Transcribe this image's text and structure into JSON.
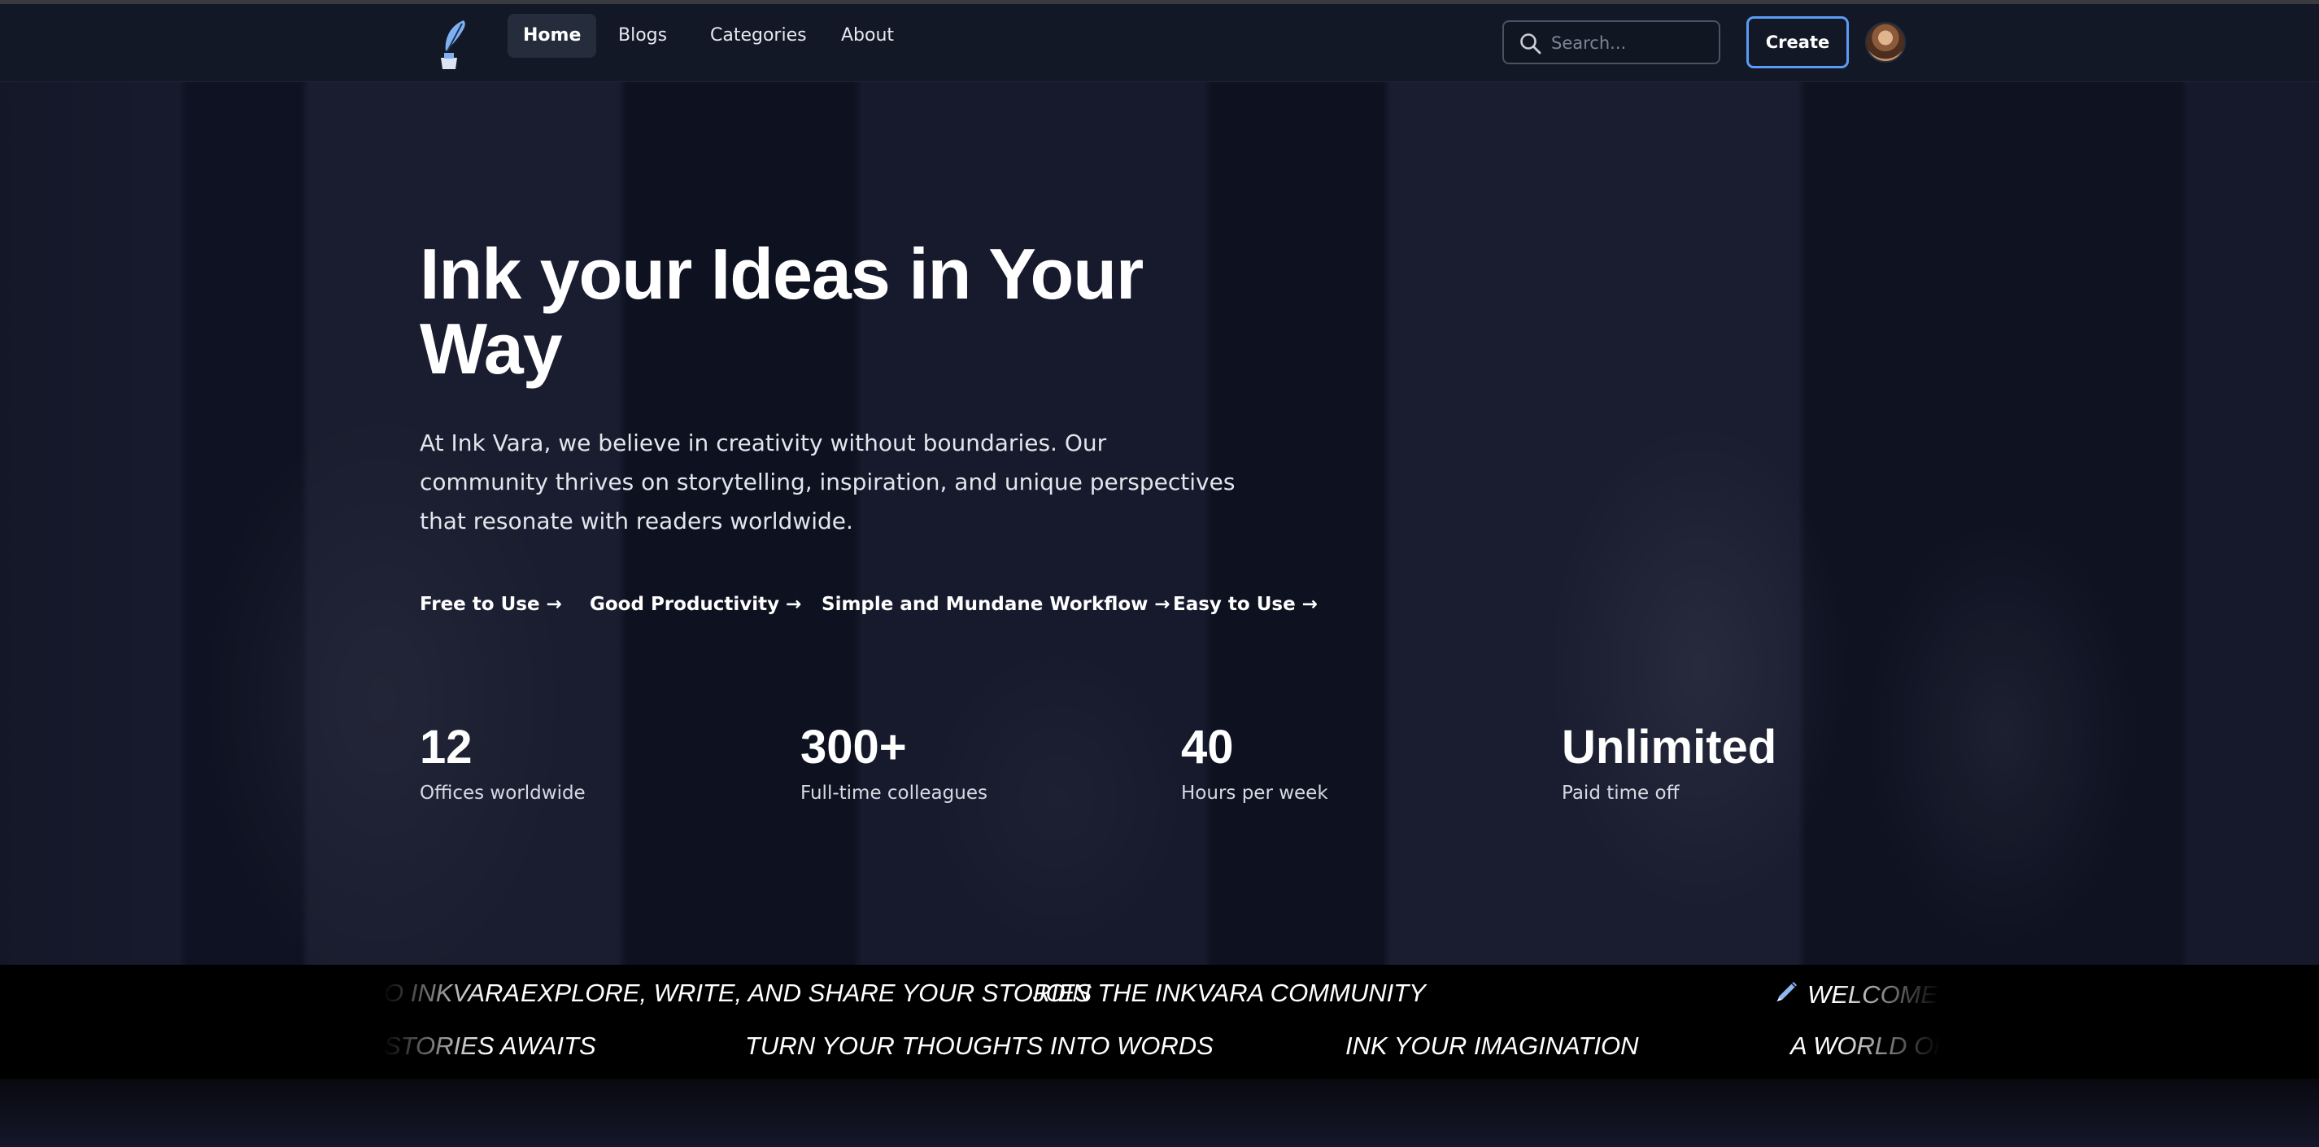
{
  "nav": {
    "items": [
      {
        "label": "Home",
        "active": true
      },
      {
        "label": "Blogs",
        "active": false
      },
      {
        "label": "Categories",
        "active": false
      },
      {
        "label": "About",
        "active": false
      }
    ],
    "search_placeholder": "Search...",
    "create_label": "Create",
    "logo_icon": "feather-ink-icon",
    "avatar_icon": "user-avatar"
  },
  "hero": {
    "title": "Ink your Ideas in Your Way",
    "description": "At Ink Vara, we believe in creativity without boundaries. Our community thrives on storytelling, inspiration, and unique perspectives that resonate with readers worldwide.",
    "features": [
      "Free to Use →",
      "Good Productivity →",
      "Simple and Mundane Workflow →",
      "Easy to Use →"
    ],
    "stats": [
      {
        "value": "12",
        "label": "Offices worldwide"
      },
      {
        "value": "300+",
        "label": "Full-time colleagues"
      },
      {
        "value": "40",
        "label": "Hours per week"
      },
      {
        "value": "Unlimited",
        "label": "Paid time off"
      }
    ]
  },
  "marquee": {
    "row1": [
      "o InkVara",
      "Explore, write, and share your stories",
      "Join the InkVara community",
      "Welcome t"
    ],
    "row1_icon": "fountain-pen-icon",
    "row2": [
      "stories awaits",
      "Turn your thoughts into words",
      "Ink your imagination",
      "A world of"
    ]
  },
  "colors": {
    "background": "#14172a",
    "navbar": "#131826",
    "accent": "#5a9cf5",
    "logo": "#7fb0f0",
    "marquee_bg": "#000000"
  }
}
